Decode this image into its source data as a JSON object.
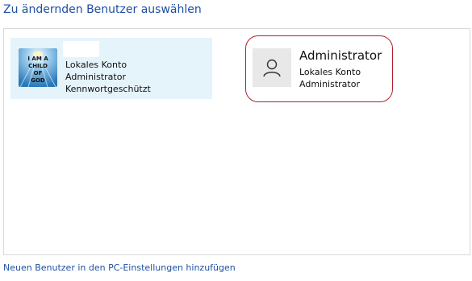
{
  "header": {
    "title": "Zu ändernden Benutzer auswählen"
  },
  "users": [
    {
      "name": "",
      "avatar": "custom-picture",
      "avatar_lettering": "I AM A CHILD OF GOD",
      "lines": [
        "Lokales Konto",
        "Administrator",
        "Kennwortgeschützt"
      ]
    },
    {
      "name": "Administrator",
      "avatar": "person-icon",
      "lines": [
        "Lokales Konto",
        "Administrator"
      ]
    }
  ],
  "footer": {
    "add_user_link": "Neuen Benutzer in den PC-Einstellungen hinzufügen"
  },
  "colors": {
    "title": "#1e4fa3",
    "selected_tile": "#e5f3fb",
    "highlight_outline": "#b21f2d"
  }
}
